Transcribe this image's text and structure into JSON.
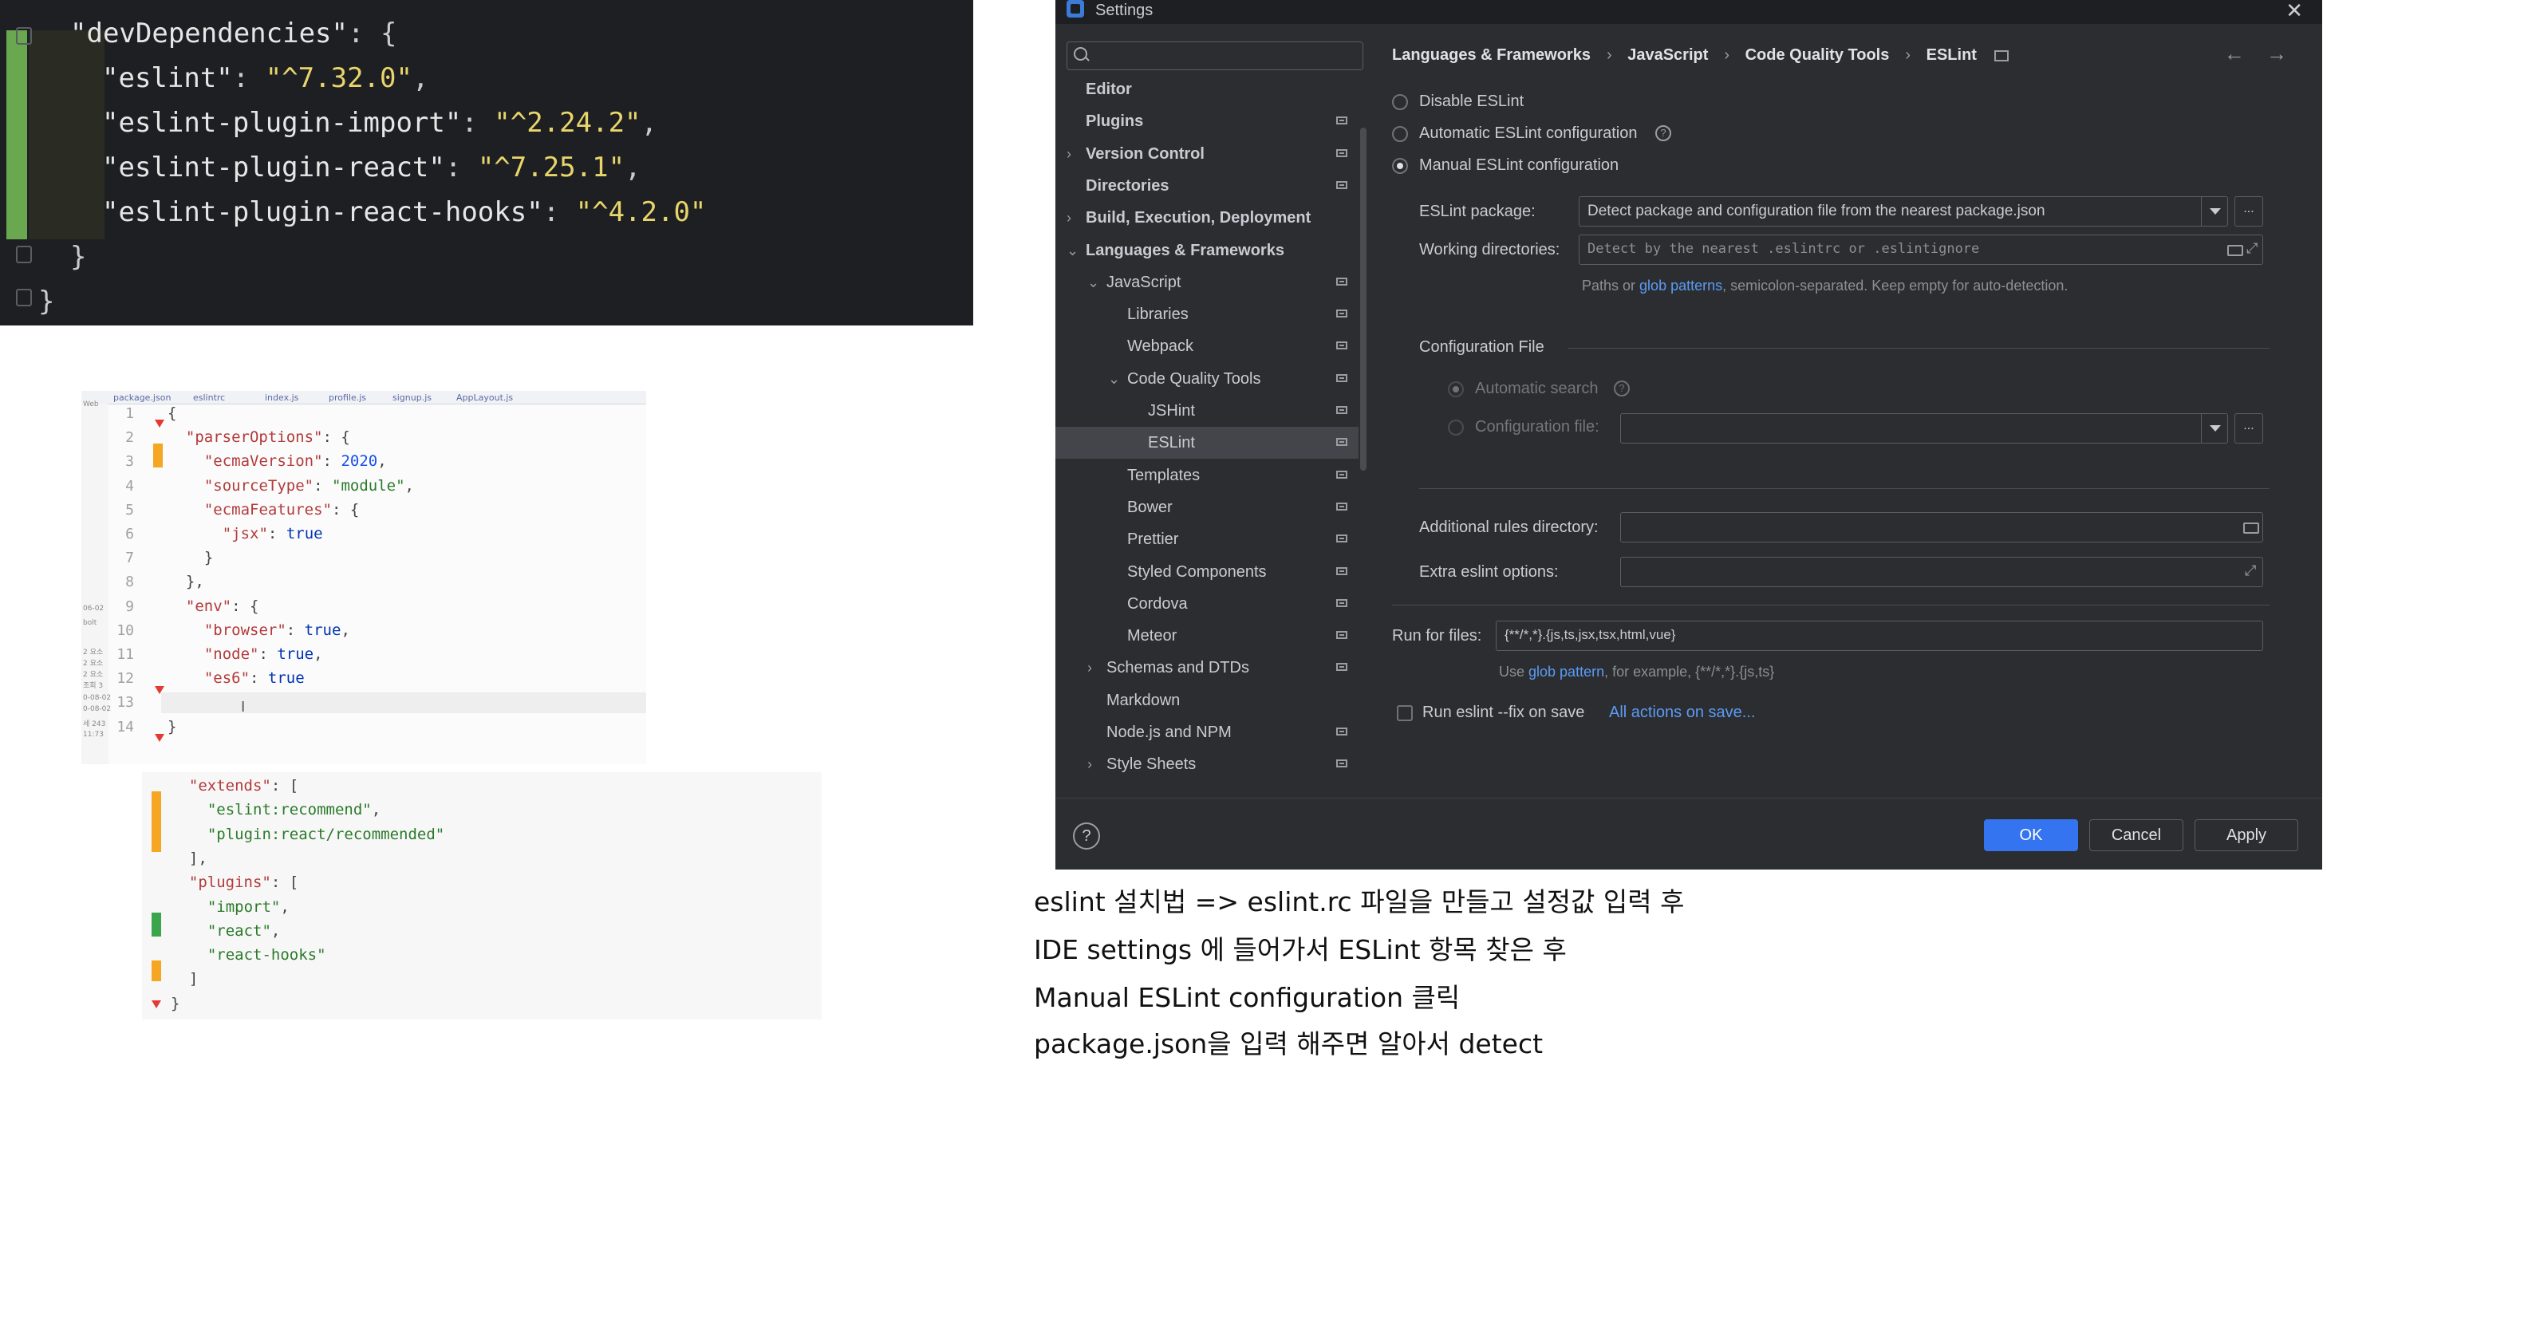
{
  "package_json": {
    "lines": [
      {
        "k": "\"devDependencies\"",
        "p": ": {"
      },
      {
        "k": "\"eslint\"",
        "p": ": ",
        "s": "\"^7.32.0\"",
        "t": ","
      },
      {
        "k": "\"eslint-plugin-import\"",
        "p": ": ",
        "s": "\"^2.24.2\"",
        "t": ","
      },
      {
        "k": "\"eslint-plugin-react\"",
        "p": ": ",
        "s": "\"^7.25.1\"",
        "t": ","
      },
      {
        "k": "\"eslint-plugin-react-hooks\"",
        "p": ": ",
        "s": "\"^4.2.0\"",
        "t": ""
      },
      {
        "p": "}"
      },
      {
        "p": "}"
      }
    ]
  },
  "eslintrc_shot": {
    "tabs": [
      "package.json",
      "eslintrc",
      "index.js",
      "profile.js",
      "signup.js",
      "AppLayout.js"
    ],
    "side_labels": [
      "Web",
      "06-02",
      "bolt",
      "2 요소",
      "2 요소",
      "2 요소",
      "조회 3",
      "0-08-02",
      "0-08-02",
      "세 243",
      "11:73"
    ],
    "line_numbers": [
      "1",
      "2",
      "3",
      "4",
      "5",
      "6",
      "7",
      "8",
      "9",
      "10",
      "11",
      "12",
      "13",
      "14"
    ],
    "code": [
      "{",
      "  \"parserOptions\": {",
      "    \"ecmaVersion\": 2020,",
      "    \"sourceType\": \"module\",",
      "    \"ecmaFeatures\": {",
      "      \"jsx\": true",
      "    }",
      "  },",
      "  \"env\": {",
      "    \"browser\": true,",
      "    \"node\": true,",
      "    \"es6\": true",
      "  }",
      "}"
    ],
    "cursor": "I"
  },
  "extends_shot": {
    "code": [
      "  \"extends\": [",
      "    \"eslint:recommend\",",
      "    \"plugin:react/recommended\"",
      "  ],",
      "  \"plugins\": [",
      "    \"import\",",
      "    \"react\",",
      "    \"react-hooks\"",
      "  ]",
      "}"
    ]
  },
  "settings": {
    "title": "Settings",
    "close": "✕",
    "search_placeholder": "",
    "tree": [
      {
        "label": "Editor",
        "bold": true,
        "level": 0,
        "chev": "",
        "pin": false
      },
      {
        "label": "Plugins",
        "bold": true,
        "level": 0,
        "chev": "",
        "pin": true
      },
      {
        "label": "Version Control",
        "bold": true,
        "level": 0,
        "chev": "›",
        "pin": true
      },
      {
        "label": "Directories",
        "bold": true,
        "level": 0,
        "chev": "",
        "pin": true
      },
      {
        "label": "Build, Execution, Deployment",
        "bold": true,
        "level": 0,
        "chev": "›",
        "pin": false
      },
      {
        "label": "Languages & Frameworks",
        "bold": true,
        "level": 0,
        "chev": "⌄",
        "pin": false
      },
      {
        "label": "JavaScript",
        "bold": false,
        "level": 1,
        "chev": "⌄",
        "pin": true
      },
      {
        "label": "Libraries",
        "bold": false,
        "level": 2,
        "chev": "",
        "pin": true
      },
      {
        "label": "Webpack",
        "bold": false,
        "level": 2,
        "chev": "",
        "pin": true
      },
      {
        "label": "Code Quality Tools",
        "bold": false,
        "level": 2,
        "chev": "⌄",
        "pin": true
      },
      {
        "label": "JSHint",
        "bold": false,
        "level": 3,
        "chev": "",
        "pin": true
      },
      {
        "label": "ESLint",
        "bold": false,
        "level": 3,
        "chev": "",
        "pin": true,
        "selected": true
      },
      {
        "label": "Templates",
        "bold": false,
        "level": 2,
        "chev": "",
        "pin": true
      },
      {
        "label": "Bower",
        "bold": false,
        "level": 2,
        "chev": "",
        "pin": true
      },
      {
        "label": "Prettier",
        "bold": false,
        "level": 2,
        "chev": "",
        "pin": true
      },
      {
        "label": "Styled Components",
        "bold": false,
        "level": 2,
        "chev": "",
        "pin": true
      },
      {
        "label": "Cordova",
        "bold": false,
        "level": 2,
        "chev": "",
        "pin": true
      },
      {
        "label": "Meteor",
        "bold": false,
        "level": 2,
        "chev": "",
        "pin": true
      },
      {
        "label": "Schemas and DTDs",
        "bold": false,
        "level": 1,
        "chev": "›",
        "pin": true
      },
      {
        "label": "Markdown",
        "bold": false,
        "level": 1,
        "chev": "",
        "pin": false
      },
      {
        "label": "Node.js and NPM",
        "bold": false,
        "level": 1,
        "chev": "",
        "pin": true
      },
      {
        "label": "Style Sheets",
        "bold": false,
        "level": 1,
        "chev": "›",
        "pin": true
      }
    ],
    "breadcrumb": [
      "Languages & Frameworks",
      "JavaScript",
      "Code Quality Tools",
      "ESLint"
    ],
    "nav_back": "←",
    "nav_forward": "→",
    "radios": {
      "disable": "Disable ESLint",
      "automatic": "Automatic ESLint configuration",
      "manual": "Manual ESLint configuration"
    },
    "selected_mode": "manual",
    "eslint_package_label": "ESLint package:",
    "eslint_package_value": "Detect package and configuration file from the nearest package.json",
    "working_dirs_label": "Working directories:",
    "working_dirs_placeholder": "Detect by the nearest .eslintrc or .eslintignore",
    "working_dirs_hint_a": "Paths or ",
    "working_dirs_hint_link": "glob patterns",
    "working_dirs_hint_b": ", semicolon-separated. Keep empty for auto-detection.",
    "config_file_group": "Configuration File",
    "automatic_search": "Automatic search",
    "configuration_file": "Configuration file:",
    "configuration_file_value": "",
    "additional_rules_label": "Additional rules directory:",
    "extra_options_label": "Extra eslint options:",
    "run_for_files_label": "Run for files:",
    "run_for_files_value": "{**/*,*}.{js,ts,jsx,tsx,html,vue}",
    "run_hint_a": "Use ",
    "run_hint_link": "glob pattern",
    "run_hint_b": ", for example, {**/*,*}.{js,ts}",
    "fix_on_save": "Run eslint --fix on save",
    "all_actions_link": "All actions on save...",
    "ellipsis": "...",
    "help_q": "?",
    "buttons": {
      "ok": "OK",
      "cancel": "Cancel",
      "apply": "Apply"
    }
  },
  "notes": [
    "eslint 설치법 => eslint.rc 파일을 만들고 설정값 입력 후",
    "IDE settings 에 들어가서 ESLint 항목 찾은 후",
    "Manual ESLint configuration 클릭",
    "package.json을 입력 해주면 알아서 detect"
  ]
}
